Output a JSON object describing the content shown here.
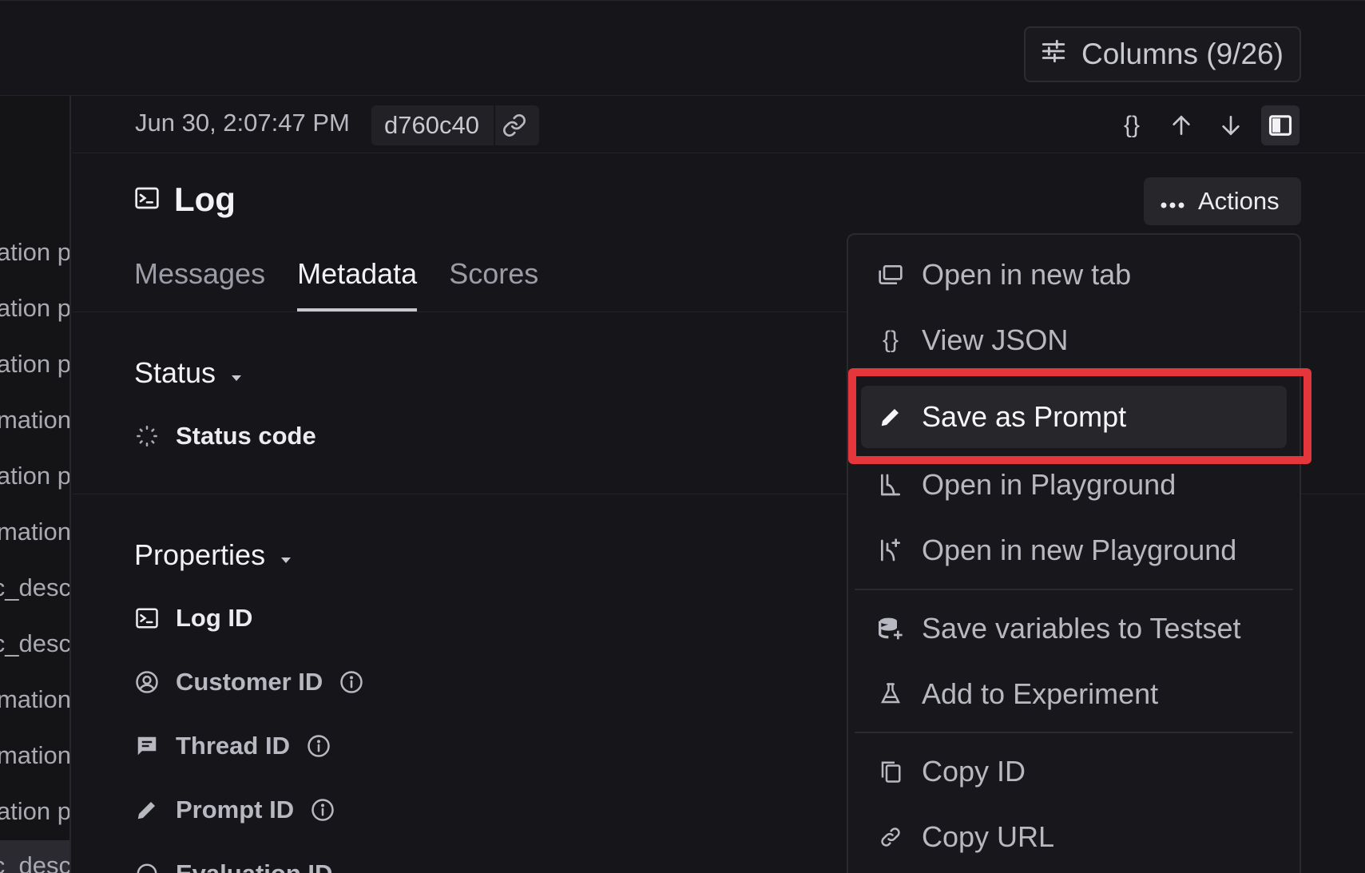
{
  "toolbar": {
    "columns_label": "Columns (9/26)"
  },
  "left_list": {
    "rows": [
      "ation p",
      "ation p",
      "ation p",
      "mation",
      "ation p",
      "mation",
      "c_desc",
      "c_desc",
      "mation",
      "mation",
      "ation p",
      "c_desc"
    ]
  },
  "detail": {
    "timestamp": "Jun 30, 2:07:47 PM",
    "hash": "d760c40",
    "title": "Log",
    "actions_label": "Actions",
    "tabs": [
      "Messages",
      "Metadata",
      "Scores"
    ],
    "active_tab": "Metadata"
  },
  "status_section": {
    "title": "Status",
    "status_code_label": "Status code"
  },
  "properties_section": {
    "title": "Properties",
    "items": [
      "Log ID",
      "Customer ID",
      "Thread ID",
      "Prompt ID",
      "Evaluation ID"
    ]
  },
  "actions_menu": {
    "items": [
      {
        "label": "Open in new tab",
        "icon": "new-tab-icon"
      },
      {
        "label": "View JSON",
        "icon": "braces-icon"
      },
      {
        "label": "Save as Prompt",
        "icon": "pencil-icon"
      },
      {
        "label": "Open in Playground",
        "icon": "playground-icon"
      },
      {
        "label": "Open in new Playground",
        "icon": "playground-plus-icon"
      },
      {
        "label": "Save variables to Testset",
        "icon": "database-plus-icon"
      },
      {
        "label": "Add to Experiment",
        "icon": "flask-icon"
      },
      {
        "label": "Copy ID",
        "icon": "copy-icon"
      },
      {
        "label": "Copy URL",
        "icon": "link-icon"
      }
    ],
    "highlighted": "Save as Prompt"
  },
  "colors": {
    "background": "#16161a",
    "highlight": "#e5363c",
    "menu_bg": "#18181c"
  }
}
